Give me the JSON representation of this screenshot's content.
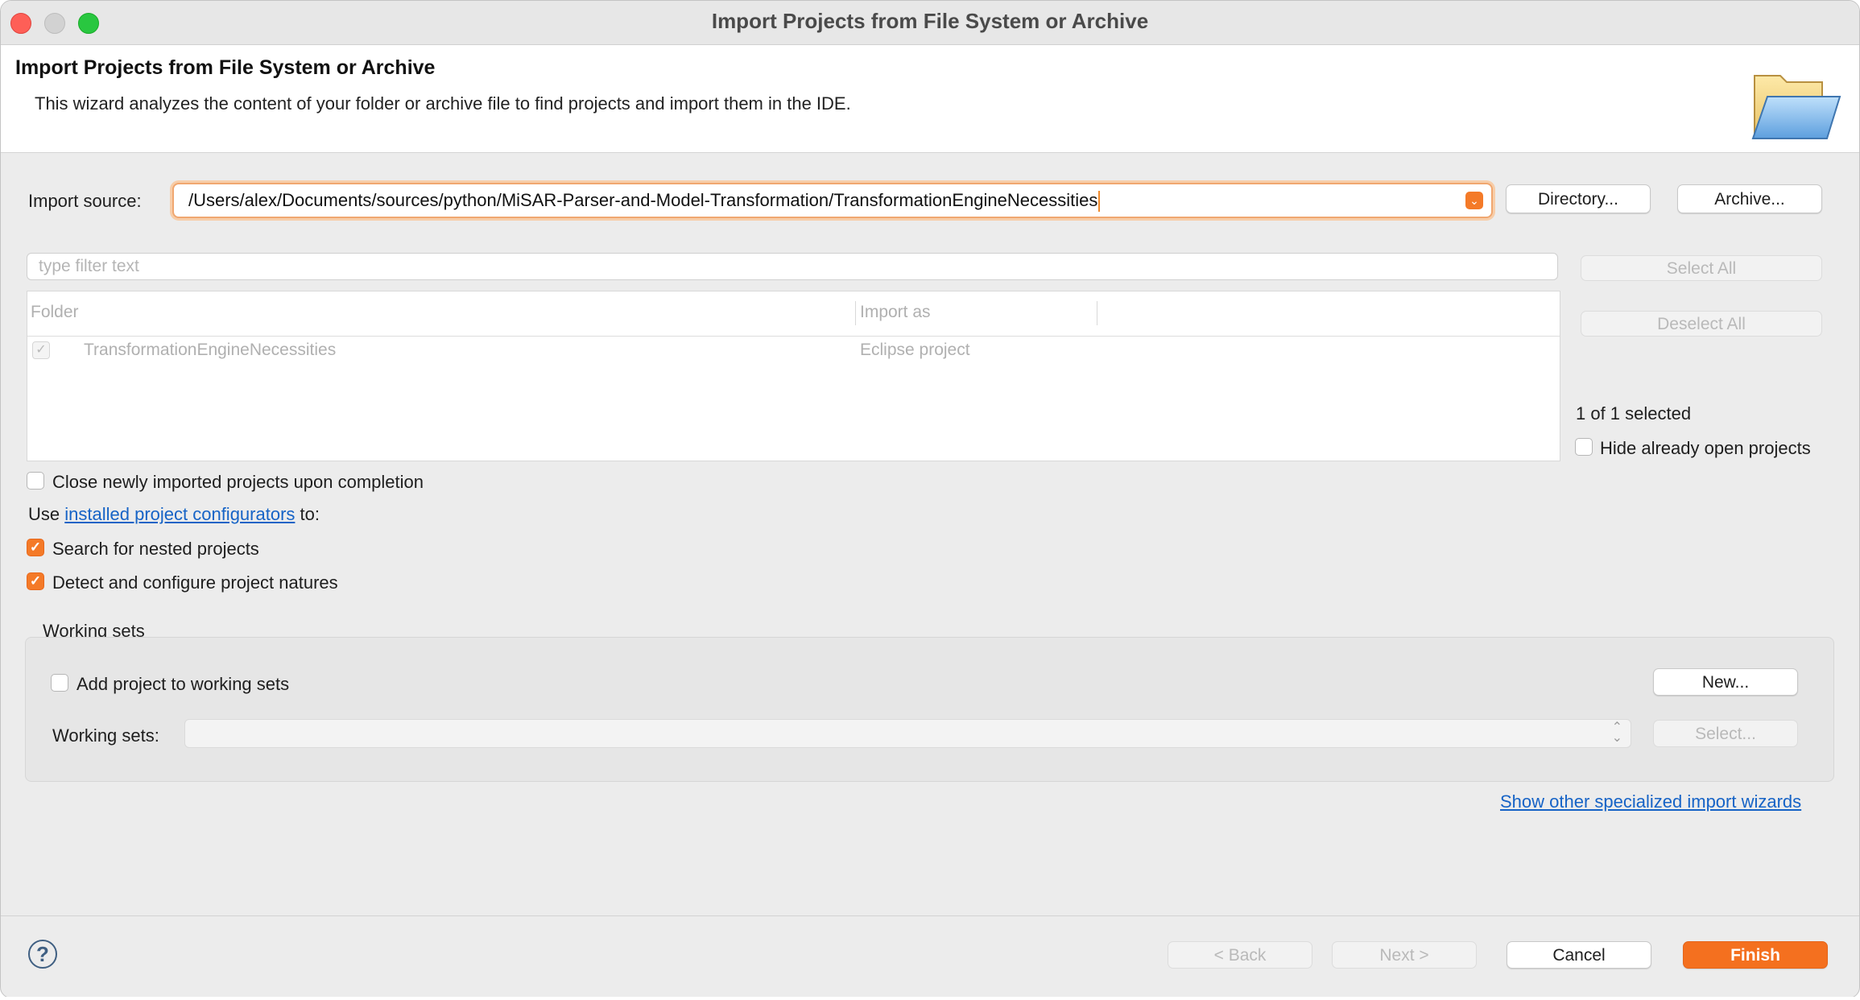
{
  "window": {
    "title": "Import Projects from File System or Archive"
  },
  "header": {
    "title": "Import Projects from File System or Archive",
    "description": "This wizard analyzes the content of your folder or archive file to find projects and import them in the IDE.",
    "icon": "folder-icon"
  },
  "source": {
    "label": "Import source:",
    "value": "/Users/alex/Documents/sources/python/MiSAR-Parser-and-Model-Transformation/TransformationEngineNecessities",
    "directory_button": "Directory...",
    "archive_button": "Archive..."
  },
  "filter": {
    "placeholder": "type filter text"
  },
  "table": {
    "columns": [
      "Folder",
      "Import as"
    ],
    "rows": [
      {
        "folder": "TransformationEngineNecessities",
        "import_as": "Eclipse project",
        "checked": true
      }
    ]
  },
  "side": {
    "select_all": "Select All",
    "deselect_all": "Deselect All",
    "selection_count": "1 of 1 selected",
    "hide_open_label": "Hide already open projects"
  },
  "options": {
    "close_label": "Close newly imported projects upon completion",
    "use_prefix": "Use",
    "configurators_link": "installed project configurators",
    "use_suffix": "to:",
    "nested_label": "Search for nested projects",
    "natures_label": "Detect and configure project natures"
  },
  "working_sets": {
    "group_label": "Working sets",
    "add_label": "Add project to working sets",
    "new_button": "New...",
    "sets_label": "Working sets:",
    "select_button": "Select..."
  },
  "other_wizards_link": "Show other specialized import wizards",
  "footer": {
    "help": "?",
    "back": "< Back",
    "next": "Next >",
    "cancel": "Cancel",
    "finish": "Finish"
  },
  "colors": {
    "accent": "#f4701f",
    "link": "#1663c6"
  }
}
